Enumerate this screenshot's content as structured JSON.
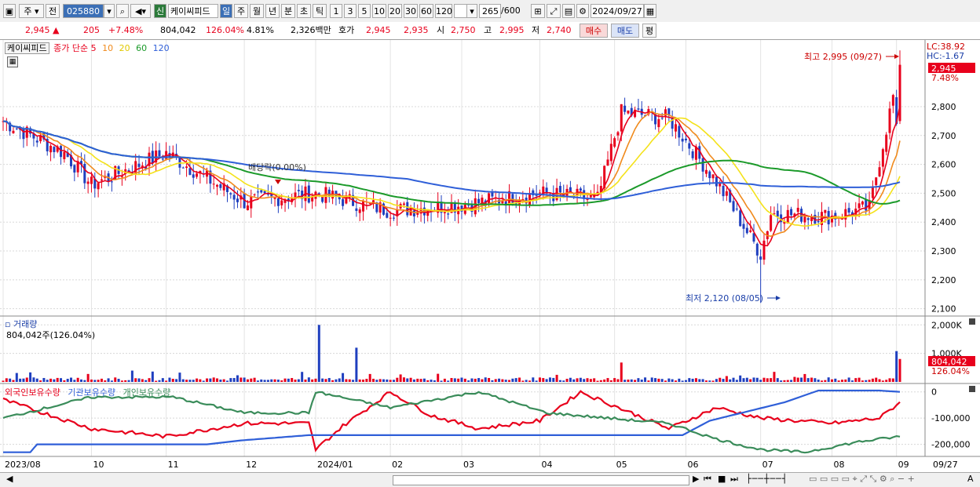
{
  "toolbar": {
    "market": "주",
    "prev": "전",
    "code": "025880",
    "new_badge": "신",
    "stock_name": "케이씨피드",
    "periods": [
      "일",
      "주",
      "월",
      "년",
      "분",
      "초",
      "틱"
    ],
    "minutes": [
      "1",
      "3",
      "5",
      "10",
      "20",
      "30",
      "60",
      "120"
    ],
    "count": "265",
    "count_max": "/600",
    "date": "2024/09/27"
  },
  "quote": {
    "price": "2,945",
    "change": "205",
    "change_pct": "+7.48%",
    "volume": "804,042",
    "volume_ratio": "126.04%",
    "turnover": "4.81%",
    "amount": "2,326백만",
    "bid_label": "호가",
    "ask": "2,945",
    "bid": "2,935",
    "open_label": "시",
    "open": "2,750",
    "high_label": "고",
    "high": "2,995",
    "low_label": "저",
    "low": "2,740",
    "buy_button": "매수",
    "sell_button": "매도",
    "eval_button": "평"
  },
  "price_panel": {
    "stock_label": "케이씨피드",
    "ma_label": "종가 단순",
    "ma_periods": [
      "5",
      "10",
      "20",
      "60",
      "120"
    ],
    "lc": "LC:38.92",
    "hc": "HC:-1.67",
    "price_tag": "2,945",
    "pct_tag": "7.48%",
    "high_note": "최고 2,995 (09/27)",
    "low_note": "최저 2,120 (08/05)",
    "dividend_note": "배당락(0.00%)"
  },
  "volume_panel": {
    "title": "거래량",
    "value": "804,042주(126.04%)",
    "tag_value": "804,042",
    "tag_pct": "126.04%"
  },
  "holder_panel": {
    "series": [
      "외국인보유수량",
      "기관보유수량",
      "개인보유수량"
    ]
  },
  "colors": {
    "up": "#e8001c",
    "down": "#1f3fbf",
    "ma5": "#e8001c",
    "ma10": "#f08a1c",
    "ma20": "#f4e21a",
    "ma60": "#1b9a2a",
    "ma120": "#2f5fd8",
    "foreign": "#e8001c",
    "institution": "#2f5fd8",
    "individual": "#3a8c5a"
  },
  "chart_data": [
    {
      "type": "candlestick",
      "title": "케이씨피드",
      "y_ticks": [
        "2,800",
        "2,700",
        "2,600",
        "2,500",
        "2,400",
        "2,300",
        "2,200",
        "2,100"
      ],
      "ylim": [
        2080,
        3020
      ],
      "x_ticks": [
        "2023/08",
        "10",
        "11",
        "12",
        "2024/01",
        "02",
        "03",
        "04",
        "05",
        "06",
        "07",
        "08",
        "09",
        "09/27"
      ],
      "last": {
        "date": "09/27",
        "open": 2750,
        "high": 2995,
        "low": 2740,
        "close": 2945
      },
      "high": {
        "date": "09/27",
        "value": 2995
      },
      "low": {
        "date": "08/05",
        "value": 2120
      },
      "series_anchor_closes": [
        {
          "date": "2023/08",
          "value": 2750
        },
        {
          "date": "09",
          "value": 2640
        },
        {
          "date": "10",
          "value": 2530
        },
        {
          "date": "11",
          "value": 2640
        },
        {
          "date": "12",
          "value": 2470
        },
        {
          "date": "2024/01",
          "value": 2500
        },
        {
          "date": "02",
          "value": 2440
        },
        {
          "date": "03",
          "value": 2460
        },
        {
          "date": "04",
          "value": 2500
        },
        {
          "date": "05",
          "value": 2480
        },
        {
          "date": "05",
          "value": 2780
        },
        {
          "date": "06",
          "value": 2760
        },
        {
          "date": "07",
          "value": 2540
        },
        {
          "date": "08",
          "value": 2290
        },
        {
          "date": "09",
          "value": 2420
        },
        {
          "date": "09/27",
          "value": 2945
        }
      ]
    },
    {
      "type": "bar",
      "title": "거래량",
      "y_ticks": [
        "2,000K",
        "1,000K"
      ],
      "ylim": [
        0,
        2200000
      ],
      "last": 804042
    },
    {
      "type": "line",
      "series": [
        {
          "name": "외국인보유수량"
        },
        {
          "name": "기관보유수량"
        },
        {
          "name": "개인보유수량"
        }
      ],
      "y_ticks": [
        "0",
        "-100,000",
        "-200,000"
      ],
      "ylim": [
        -240000,
        20000
      ]
    }
  ]
}
